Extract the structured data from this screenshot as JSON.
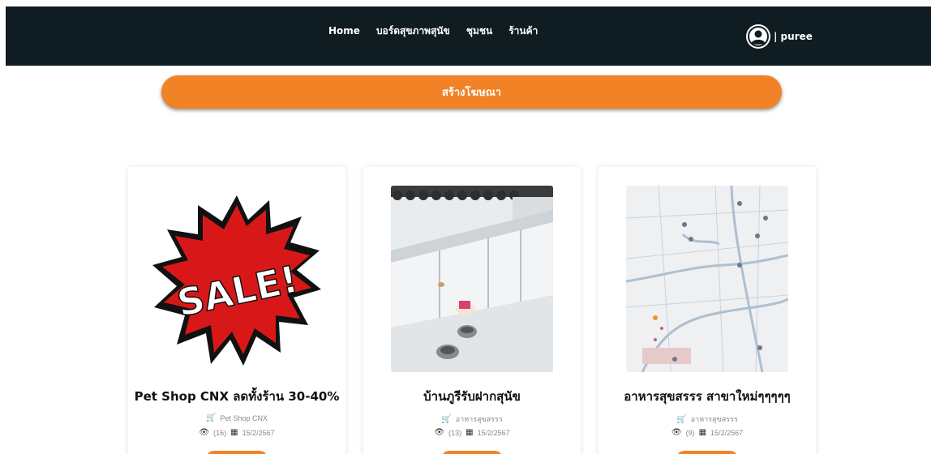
{
  "nav": {
    "items": [
      "Home",
      "บอร์ดสุขภาพสุนัข",
      "ชุมชน",
      "ร้านค้า"
    ],
    "user_name": "| puree"
  },
  "create_ad_label": "สร้างโฆษณา",
  "cards": [
    {
      "title": "Pet Shop CNX ลดทั้งร้าน 30-40%",
      "shop": "Pet Shop CNX",
      "views": "(16)",
      "date": "15/2/2567",
      "image": "sale-starburst"
    },
    {
      "title": "บ้านภูรีรับฝากสุนัข",
      "shop": "อาหารสุขสรรร",
      "views": "(13)",
      "date": "15/2/2567",
      "image": "dog-kennel-photo"
    },
    {
      "title": "อาหารสุขสรรร สาขาใหม่ๆๆๆๆๆ",
      "shop": "อาหารสุขสรรร",
      "views": "(9)",
      "date": "15/2/2567",
      "image": "map"
    }
  ],
  "colors": {
    "navbar": "#0f1d23",
    "accent": "#f18226"
  }
}
